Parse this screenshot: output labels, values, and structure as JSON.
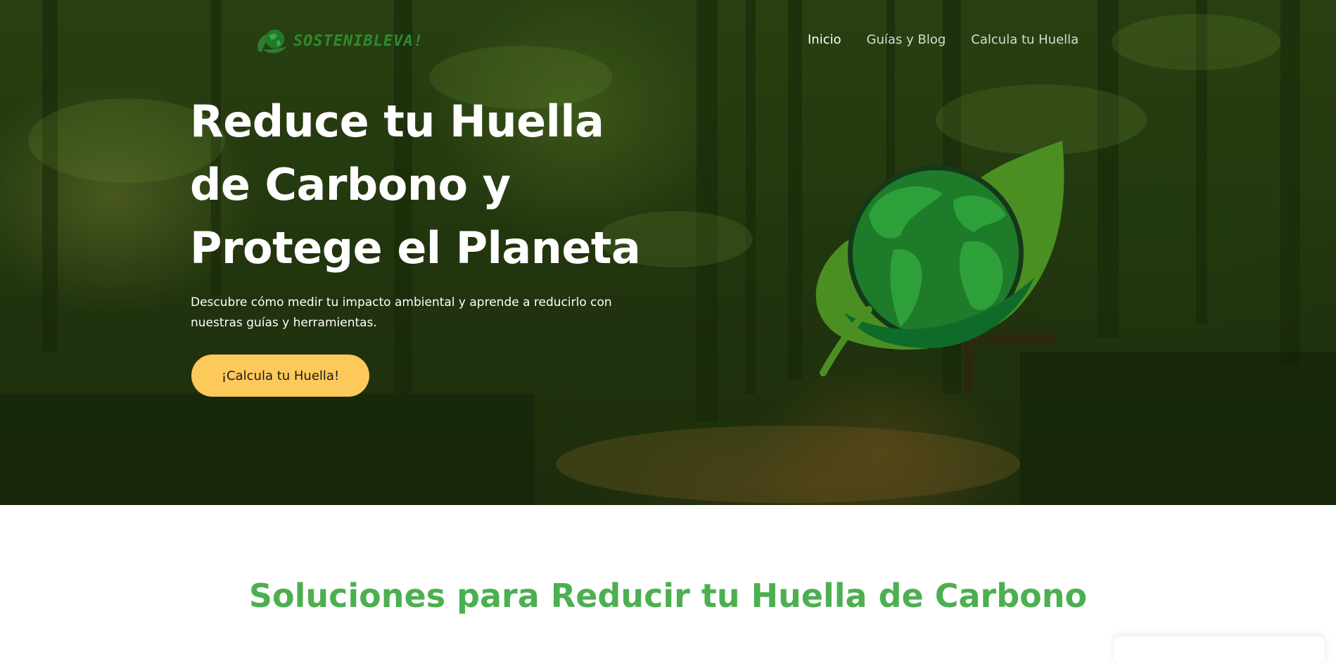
{
  "header": {
    "logo_text": "SOSTENIBLEVA!",
    "logo_icon": "globe-leaf-icon",
    "nav": [
      {
        "label": "Inicio",
        "active": true
      },
      {
        "label": "Guías y Blog",
        "active": false
      },
      {
        "label": "Calcula tu Huella",
        "active": false
      }
    ]
  },
  "hero": {
    "title_lines": [
      "Reduce tu Huella",
      "de Carbono y",
      "Protege el Planeta"
    ],
    "subtitle_lines": [
      "Descubre cómo medir tu impacto ambiental y aprende a reducirlo con",
      "nuestras guías y herramientas."
    ],
    "cta_label": "¡Calcula tu Huella!",
    "illustration": "globe-leaf-icon"
  },
  "section": {
    "title": "Soluciones para Reducir tu Huella de Carbono"
  },
  "colors": {
    "accent_green": "#4caf50",
    "cta_yellow": "#fdc95a",
    "forest_dark": "#263a10",
    "globe_green": "#228b22",
    "leaf_green": "#4b8f23"
  }
}
